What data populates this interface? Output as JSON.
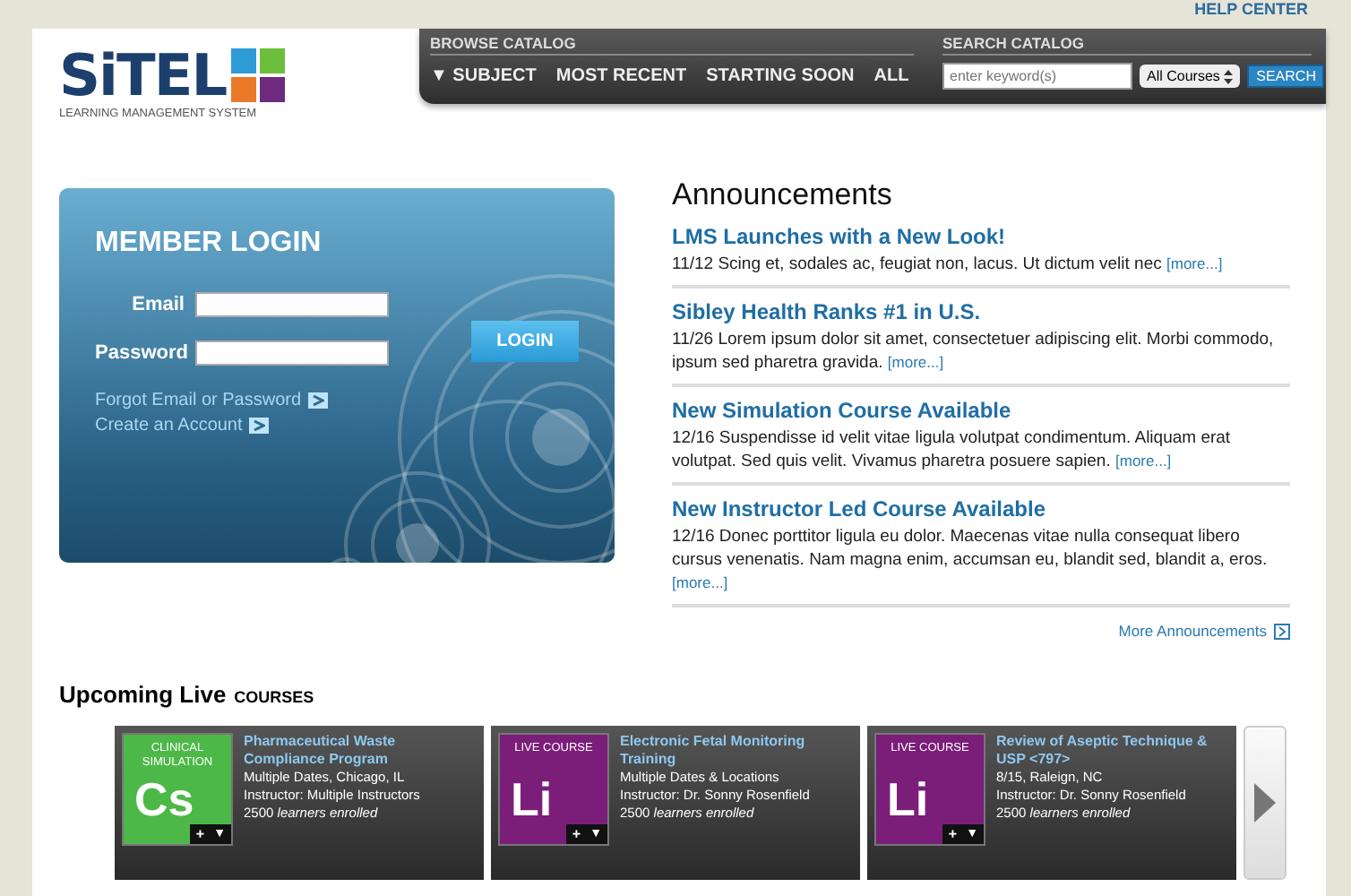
{
  "top_link": "HELP CENTER",
  "logo": {
    "name": "SiTEL",
    "tagline": "LEARNING MANAGEMENT SYSTEM"
  },
  "browse": {
    "title": "BROWSE CATALOG",
    "items": [
      {
        "label": "▼ SUBJECT"
      },
      {
        "label": "MOST RECENT"
      },
      {
        "label": "STARTING SOON"
      },
      {
        "label": "ALL"
      }
    ]
  },
  "search": {
    "title": "SEARCH CATALOG",
    "placeholder": "enter keyword(s)",
    "scope": "All Courses",
    "button": "SEARCH"
  },
  "login": {
    "title": "MEMBER LOGIN",
    "email_label": "Email",
    "password_label": "Password",
    "button": "LOGIN",
    "links": [
      "Forgot Email or Password",
      "Create an Account"
    ]
  },
  "announcements": {
    "title": "Announcements",
    "items": [
      {
        "headline": "LMS Launches with a New Look!",
        "body": "11/12 Scing et, sodales ac, feugiat non, lacus. Ut dictum velit nec",
        "more": "[more...]"
      },
      {
        "headline": "Sibley Health Ranks #1 in U.S.",
        "body": "11/26 Lorem ipsum dolor sit amet, consectetuer adipiscing elit. Morbi commodo, ipsum sed pharetra gravida.",
        "more": "[more...]"
      },
      {
        "headline": "New Simulation Course Available",
        "body": "12/16 Suspendisse id velit vitae ligula volutpat condimentum. Aliquam erat volutpat. Sed quis velit. Vivamus pharetra posuere sapien.",
        "more": "[more...]"
      },
      {
        "headline": "New Instructor Led Course Available",
        "body": "12/16 Donec porttitor ligula eu dolor. Maecenas vitae nulla consequat libero cursus venenatis. Nam magna enim, accumsan eu, blandit sed, blandit a, eros.",
        "more": "[more...]"
      }
    ],
    "more_link": "More Announcements"
  },
  "courses": {
    "title": "Upcoming Live",
    "subtitle": "COURSES",
    "items": [
      {
        "badge": "CLINICAL SIMULATION",
        "letters": "Cs",
        "color": "#4cb848",
        "add": "+",
        "menu": "▼",
        "title": "Pharmaceutical Waste Compliance Program",
        "when": "Multiple Dates, Chicago, IL",
        "instructor": "Instructor: Multiple Instructors",
        "enrolled": "2500 *learners enrolled*"
      },
      {
        "badge": "LIVE COURSE",
        "letters": "Li",
        "color": "#7b1e7a",
        "add": "+",
        "menu": "▼",
        "title": "Electronic Fetal Monitoring Training",
        "when": "Multiple Dates & Locations",
        "instructor": "Instructor: Dr. Sonny Rosenfield",
        "enrolled": "2500 *learners enrolled*"
      },
      {
        "badge": "LIVE COURSE",
        "letters": "Li",
        "color": "#7b1e7a",
        "add": "+",
        "menu": "▼",
        "title": "Review of Aseptic Technique & USP <797>",
        "when": "8/15, Raleign, NC",
        "instructor": "Instructor: Dr. Sonny Rosenfield",
        "enrolled": "2500 *learners enrolled*"
      }
    ]
  }
}
